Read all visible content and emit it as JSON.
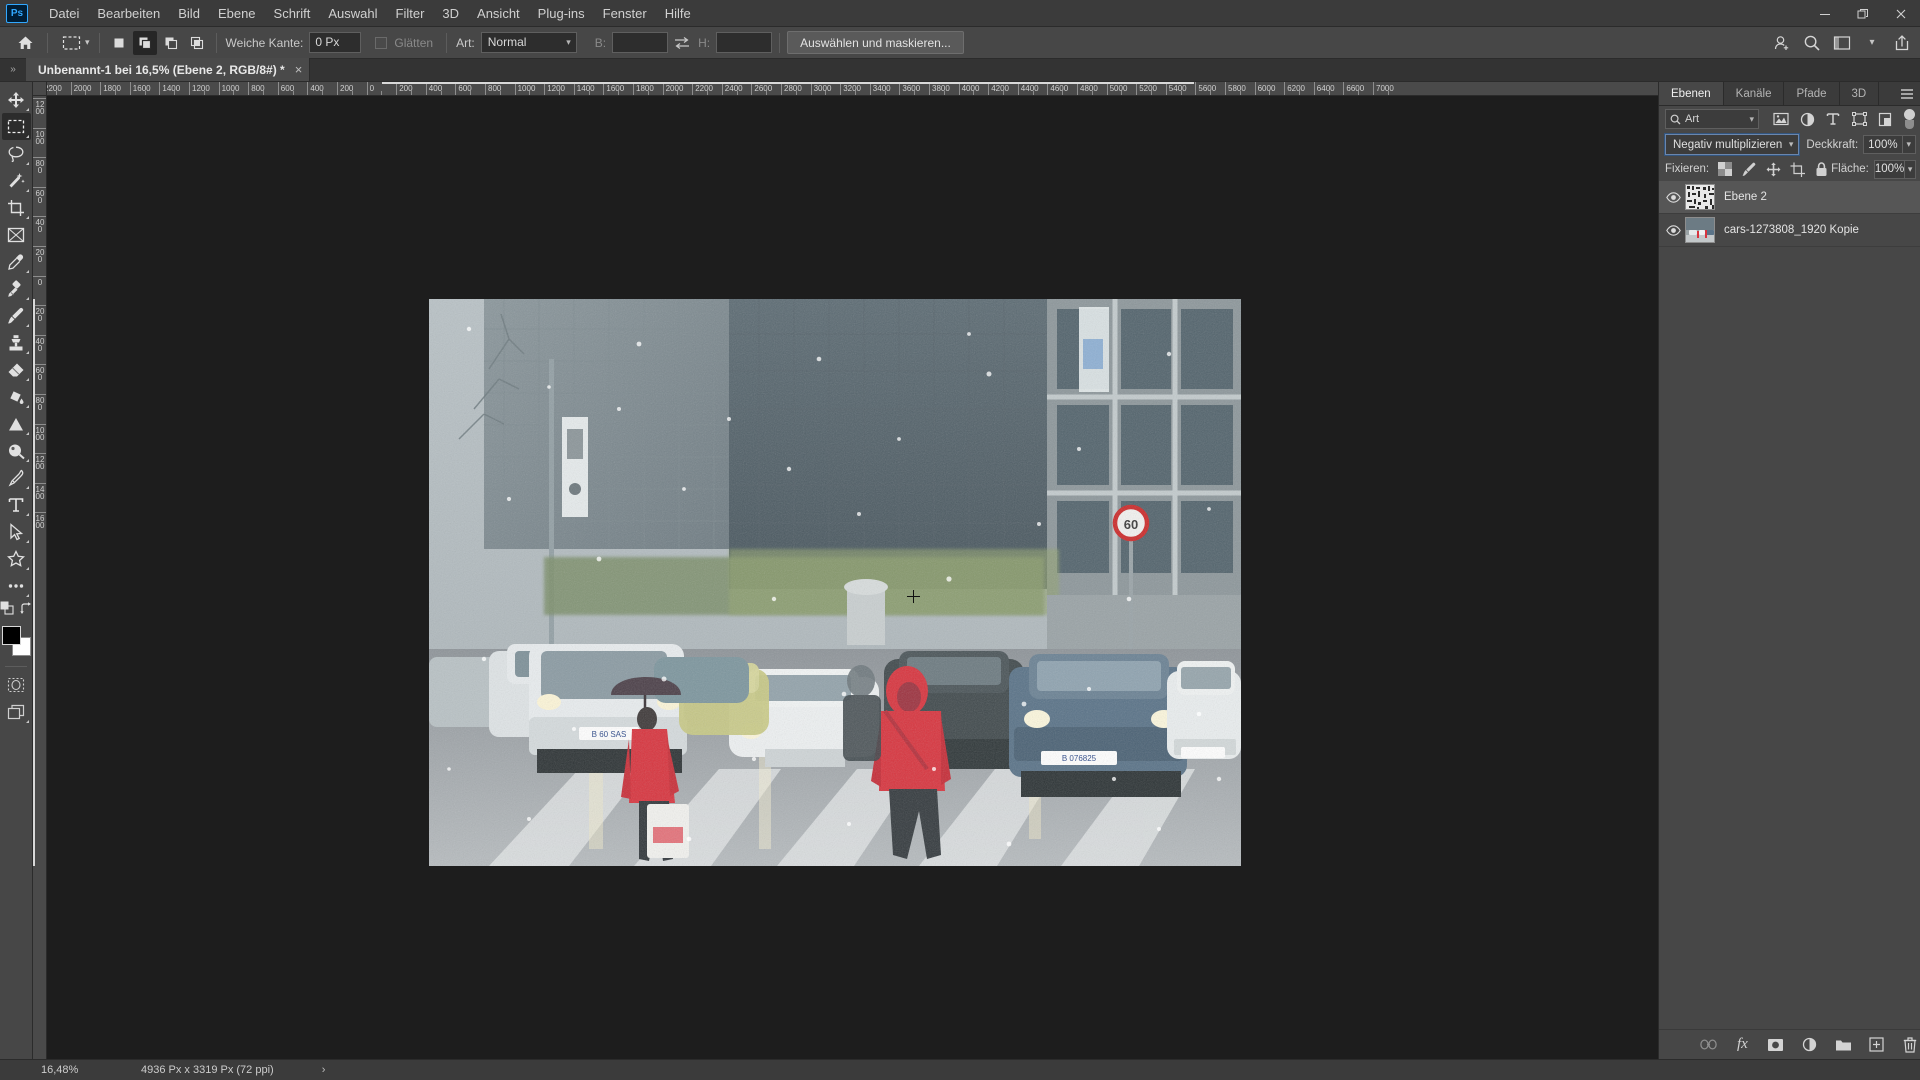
{
  "app": {
    "logo": "Ps",
    "menus": [
      "Datei",
      "Bearbeiten",
      "Bild",
      "Ebene",
      "Schrift",
      "Auswahl",
      "Filter",
      "3D",
      "Ansicht",
      "Plug-ins",
      "Fenster",
      "Hilfe"
    ],
    "window_controls": {
      "minimize": "minimize-icon",
      "restore": "restore-icon",
      "close": "close-icon"
    }
  },
  "options_bar": {
    "home_icon": "home-icon",
    "tool_preset_icon": "rectangular-marquee-icon",
    "selection_modes": [
      "new-selection",
      "add-to-selection",
      "subtract-from-selection",
      "intersect-selection"
    ],
    "active_selection_mode_index": 1,
    "feather_label": "Weiche Kante:",
    "feather_value": "0 Px",
    "antialias_label": "Glätten",
    "antialias_checked": false,
    "style_label": "Art:",
    "style_value": "Normal",
    "width_label": "B:",
    "width_value": "",
    "swap_icon": "swap-dimensions-icon",
    "height_label": "H:",
    "height_value": "",
    "select_and_mask_label": "Auswählen und maskieren...",
    "right_icons": [
      "user-add-icon",
      "search-icon",
      "workspace-icon",
      "chevron-down-icon",
      "share-icon"
    ]
  },
  "tab_bar": {
    "collapse_icon": "collapse-panels-icon",
    "document_title": "Unbenannt-1 bei 16,5% (Ebene 2, RGB/8#) *",
    "close_label": "×"
  },
  "toolbar": {
    "tools": [
      {
        "name": "move-tool",
        "icon": "move-icon",
        "active": false,
        "has_flyout": true
      },
      {
        "name": "rectangular-marquee-tool",
        "icon": "marquee-icon",
        "active": true,
        "has_flyout": true
      },
      {
        "name": "lasso-tool",
        "icon": "lasso-icon",
        "active": false,
        "has_flyout": true
      },
      {
        "name": "quick-selection-tool",
        "icon": "magic-wand-icon",
        "active": false,
        "has_flyout": true
      },
      {
        "name": "crop-tool",
        "icon": "crop-icon",
        "active": false,
        "has_flyout": true
      },
      {
        "name": "frame-tool",
        "icon": "frame-icon",
        "active": false,
        "has_flyout": false
      },
      {
        "name": "eyedropper-tool",
        "icon": "eyedropper-icon",
        "active": false,
        "has_flyout": true
      },
      {
        "name": "spot-healing-brush-tool",
        "icon": "healing-brush-icon",
        "active": false,
        "has_flyout": true
      },
      {
        "name": "brush-tool",
        "icon": "brush-icon",
        "active": false,
        "has_flyout": true
      },
      {
        "name": "clone-stamp-tool",
        "icon": "clone-stamp-icon",
        "active": false,
        "has_flyout": true
      },
      {
        "name": "eraser-tool",
        "icon": "eraser-icon",
        "active": false,
        "has_flyout": true
      },
      {
        "name": "gradient-tool",
        "icon": "paint-bucket-icon",
        "active": false,
        "has_flyout": true
      },
      {
        "name": "blur-tool",
        "icon": "blur-triangle-icon",
        "active": false,
        "has_flyout": true
      },
      {
        "name": "dodge-tool",
        "icon": "dodge-icon",
        "active": false,
        "has_flyout": true
      },
      {
        "name": "pen-tool",
        "icon": "pen-icon",
        "active": false,
        "has_flyout": true
      },
      {
        "name": "type-tool",
        "icon": "type-icon",
        "active": false,
        "has_flyout": true
      },
      {
        "name": "path-selection-tool",
        "icon": "path-arrow-icon",
        "active": false,
        "has_flyout": true
      },
      {
        "name": "custom-shape-tool",
        "icon": "shape-star-icon",
        "active": false,
        "has_flyout": true
      },
      {
        "name": "edit-toolbar",
        "icon": "more-dots-icon",
        "active": false,
        "has_flyout": true
      }
    ],
    "foreground_color": "#000000",
    "background_color": "#ffffff",
    "quick_mask_icon": "quick-mask-icon",
    "screen_mode_icon": "screen-mode-icon",
    "swap_colors_icon": "swap-colors-icon",
    "default_colors_icon": "default-colors-icon"
  },
  "rulers": {
    "unit": "Px",
    "horizontal_labels": [
      "2200",
      "2000",
      "1800",
      "1600",
      "1400",
      "1200",
      "1000",
      "800",
      "600",
      "400",
      "200",
      "0",
      "200",
      "400",
      "600",
      "800",
      "1000",
      "1200",
      "1400",
      "1600",
      "1800",
      "2000",
      "2200",
      "2400",
      "2600",
      "2800",
      "3000",
      "3200",
      "3400",
      "3600",
      "3800",
      "4000",
      "4200",
      "4400",
      "4600",
      "4800",
      "5000",
      "5200",
      "5400",
      "5600",
      "5800",
      "6000",
      "6200",
      "6400",
      "6600",
      "7000"
    ],
    "vertical_labels": [
      "1200",
      "1000",
      "800",
      "600",
      "400",
      "200",
      "0",
      "200",
      "400",
      "600",
      "800",
      "1000",
      "1200",
      "1400",
      "1600"
    ]
  },
  "canvas": {
    "scene_description": "street-photo-rain-pedestrians",
    "speed_limit_sign": "60",
    "license_plate_left": "B 60 SAS",
    "license_plate_right": "B 076825",
    "cursor_icon": "crosshair-cursor"
  },
  "status_bar": {
    "zoom": "16,48%",
    "doc_size": "4936 Px x 3319 Px (72 ppi)",
    "expand_icon": "chevron-right-icon"
  },
  "right_dock": {
    "panel_tabs": [
      {
        "label": "Ebenen",
        "active": true
      },
      {
        "label": "Kanäle",
        "active": false
      },
      {
        "label": "Pfade",
        "active": false
      },
      {
        "label": "3D",
        "active": false
      }
    ],
    "panel_menu_icon": "panel-menu-icon",
    "layers_panel": {
      "filter_search_placeholder": "Art",
      "filter_search_value": "Art",
      "filter_icons": [
        "pixel-filter-icon",
        "adjustment-filter-icon",
        "type-filter-icon",
        "shape-filter-icon",
        "smart-object-filter-icon"
      ],
      "filter_toggle": "filter-enable-toggle",
      "blend_mode": "Negativ multiplizieren",
      "opacity_label": "Deckkraft:",
      "opacity_value": "100%",
      "lock_label": "Fixieren:",
      "lock_icons": [
        "lock-transparent-pixels-icon",
        "lock-image-pixels-icon",
        "lock-position-icon",
        "lock-artboard-nesting-icon",
        "lock-all-icon"
      ],
      "fill_label": "Fläche:",
      "fill_value": "100%",
      "layers": [
        {
          "name": "Ebene 2",
          "visible": true,
          "selected": true,
          "thumb": "noise-layer-thumbnail",
          "has_mask": false
        },
        {
          "name": "cars-1273808_1920 Kopie",
          "visible": true,
          "selected": false,
          "thumb": "photo-layer-thumbnail",
          "has_mask": false
        }
      ],
      "footer_icons": [
        "link-layers-icon",
        "layer-fx-icon",
        "layer-mask-icon",
        "adjustment-layer-icon",
        "new-group-icon",
        "new-layer-icon",
        "delete-layer-icon"
      ]
    }
  }
}
